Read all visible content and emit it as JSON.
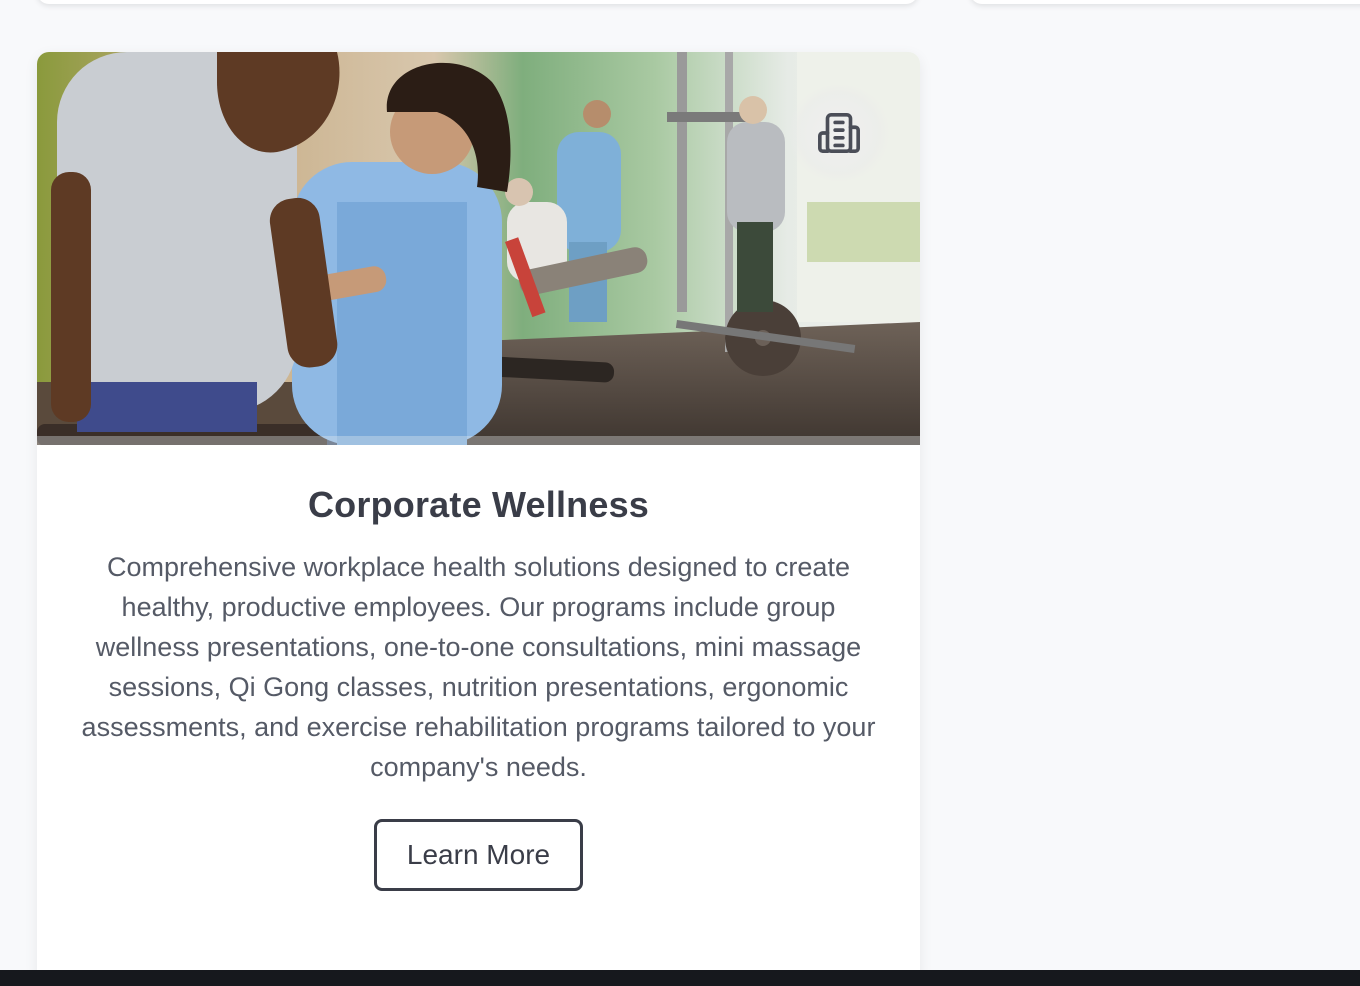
{
  "service_card": {
    "image_alt": "Physical therapist assisting a patient walking between parallel bars in a rehabilitation gym",
    "icon": "building-icon",
    "title": "Corporate Wellness",
    "description": "Comprehensive workplace health solutions designed to create healthy, productive employees. Our programs include group wellness presentations, one-to-one consultations, mini massage sessions, Qi Gong classes, nutrition presentations, ergonomic assessments, and exercise rehabilitation programs tailored to your company's needs.",
    "button_label": "Learn More"
  },
  "colors": {
    "page_background": "#f8f9fb",
    "card_background": "#ffffff",
    "title_text": "#3a3d48",
    "body_text": "#555a66",
    "footer_bar": "#16181d"
  }
}
